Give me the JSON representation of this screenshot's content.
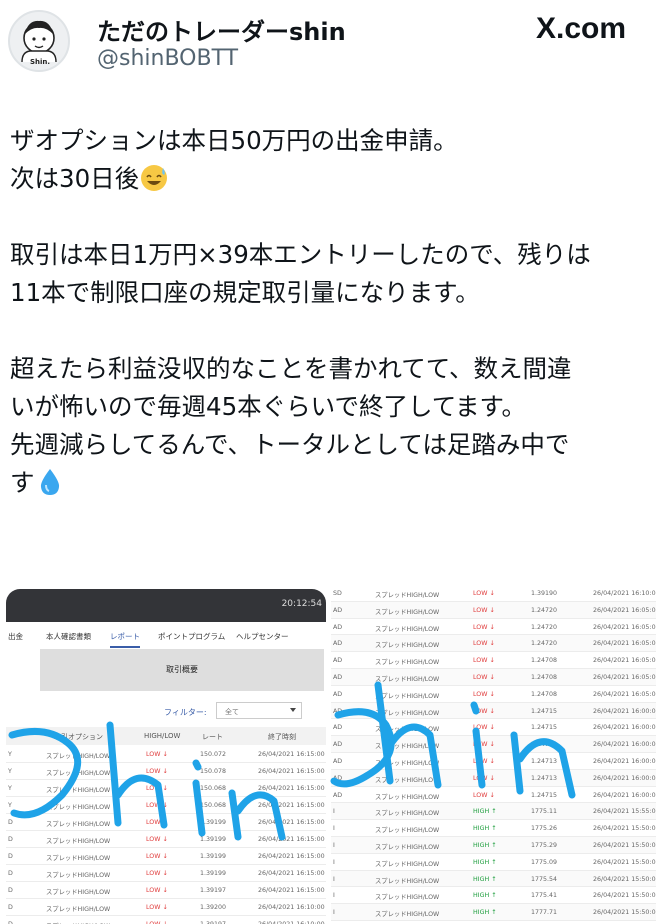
{
  "post": {
    "display_name": "ただのトレーダーshin",
    "handle": "@shinBOBTT",
    "site": "X.com",
    "avatar_label": "Shin.",
    "lines": [
      "ザオプションは本日50万円の出金申請。",
      "次は30日後",
      "",
      "取引は本日1万円×39本エントリーしたので、残りは",
      "11本で制限口座の規定取引量になります。",
      "",
      "超えたら利益没収的なことを書かれてて、数え間違",
      "いが怖いので毎週45本ぐらいで終了してます。",
      "先週減らしてるんで、トータルとしては足踏み中で",
      "す"
    ],
    "emojis": [
      "sweat-smile-emoji",
      "droplet-emoji"
    ]
  },
  "left_screenshot": {
    "clock": "20:12:54",
    "tabs": [
      "出金",
      "本人確認書類",
      "レポート",
      "ポイントプログラム",
      "ヘルプセンター"
    ],
    "active_tab": "レポート",
    "summary_button": "取引概要",
    "filter_label": "フィルター:",
    "filter_value": "全て",
    "headers": [
      "取引オプション",
      "HIGH/LOW",
      "レート",
      "終了時刻"
    ],
    "rows": [
      {
        "pair": "Y",
        "option": "スプレッドHIGH/LOW",
        "dir": "LOW",
        "rate": "150.072",
        "time": "26/04/2021 16:15:00"
      },
      {
        "pair": "Y",
        "option": "スプレッドHIGH/LOW",
        "dir": "LOW",
        "rate": "150.078",
        "time": "26/04/2021 16:15:00"
      },
      {
        "pair": "Y",
        "option": "スプレッドHIGH/LOW",
        "dir": "LOW",
        "rate": "150.068",
        "time": "26/04/2021 16:15:00"
      },
      {
        "pair": "Y",
        "option": "スプレッドHIGH/LOW",
        "dir": "LOW",
        "rate": "150.068",
        "time": "26/04/2021 16:15:00"
      },
      {
        "pair": "D",
        "option": "スプレッドHIGH/LOW",
        "dir": "LOW",
        "rate": "1.39199",
        "time": "26/04/2021 16:15:00"
      },
      {
        "pair": "D",
        "option": "スプレッドHIGH/LOW",
        "dir": "LOW",
        "rate": "1.39199",
        "time": "26/04/2021 16:15:00"
      },
      {
        "pair": "D",
        "option": "スプレッドHIGH/LOW",
        "dir": "LOW",
        "rate": "1.39199",
        "time": "26/04/2021 16:15:00"
      },
      {
        "pair": "D",
        "option": "スプレッドHIGH/LOW",
        "dir": "LOW",
        "rate": "1.39199",
        "time": "26/04/2021 16:15:00"
      },
      {
        "pair": "D",
        "option": "スプレッドHIGH/LOW",
        "dir": "LOW",
        "rate": "1.39197",
        "time": "26/04/2021 16:15:00"
      },
      {
        "pair": "D",
        "option": "スプレッドHIGH/LOW",
        "dir": "LOW",
        "rate": "1.39200",
        "time": "26/04/2021 16:10:00"
      },
      {
        "pair": "D",
        "option": "スプレッドHIGH/LOW",
        "dir": "LOW",
        "rate": "1.39197",
        "time": "26/04/2021 16:10:00"
      }
    ]
  },
  "right_screenshot": {
    "rows": [
      {
        "pair": "SD",
        "option": "スプレッドHIGH/LOW",
        "dir": "LOW",
        "rate": "1.39190",
        "time": "26/04/2021 16:10:0"
      },
      {
        "pair": "AD",
        "option": "スプレッドHIGH/LOW",
        "dir": "LOW",
        "rate": "1.24720",
        "time": "26/04/2021 16:05:00"
      },
      {
        "pair": "AD",
        "option": "スプレッドHIGH/LOW",
        "dir": "LOW",
        "rate": "1.24720",
        "time": "26/04/2021 16:05:00"
      },
      {
        "pair": "AD",
        "option": "スプレッドHIGH/LOW",
        "dir": "LOW",
        "rate": "1.24720",
        "time": "26/04/2021 16:05:00"
      },
      {
        "pair": "AD",
        "option": "スプレッドHIGH/LOW",
        "dir": "LOW",
        "rate": "1.24708",
        "time": "26/04/2021 16:05:00"
      },
      {
        "pair": "AD",
        "option": "スプレッドHIGH/LOW",
        "dir": "LOW",
        "rate": "1.24708",
        "time": "26/04/2021 16:05:00"
      },
      {
        "pair": "AD",
        "option": "スプレッドHIGH/LOW",
        "dir": "LOW",
        "rate": "1.24708",
        "time": "26/04/2021 16:05:00"
      },
      {
        "pair": "AD",
        "option": "スプレッドHIGH/LOW",
        "dir": "LOW",
        "rate": "1.24715",
        "time": "26/04/2021 16:00:00"
      },
      {
        "pair": "AD",
        "option": "スプレッドHIGH/LOW",
        "dir": "LOW",
        "rate": "1.24715",
        "time": "26/04/2021 16:00:00"
      },
      {
        "pair": "AD",
        "option": "スプレッドHIGH/LOW",
        "dir": "LOW",
        "rate": "1.24714",
        "time": "26/04/2021 16:00:00"
      },
      {
        "pair": "AD",
        "option": "スプレッドHIGH/LOW",
        "dir": "LOW",
        "rate": "1.24713",
        "time": "26/04/2021 16:00:00"
      },
      {
        "pair": "AD",
        "option": "スプレッドHIGH/LOW",
        "dir": "LOW",
        "rate": "1.24713",
        "time": "26/04/2021 16:00:00"
      },
      {
        "pair": "AD",
        "option": "スプレッドHIGH/LOW",
        "dir": "LOW",
        "rate": "1.24715",
        "time": "26/04/2021 16:00:00"
      },
      {
        "pair": "I",
        "option": "スプレッドHIGH/LOW",
        "dir": "HIGH",
        "rate": "1775.11",
        "time": "26/04/2021 15:55:00"
      },
      {
        "pair": "I",
        "option": "スプレッドHIGH/LOW",
        "dir": "HIGH",
        "rate": "1775.26",
        "time": "26/04/2021 15:50:00"
      },
      {
        "pair": "I",
        "option": "スプレッドHIGH/LOW",
        "dir": "HIGH",
        "rate": "1775.29",
        "time": "26/04/2021 15:50:00"
      },
      {
        "pair": "I",
        "option": "スプレッドHIGH/LOW",
        "dir": "HIGH",
        "rate": "1775.09",
        "time": "26/04/2021 15:50:00"
      },
      {
        "pair": "I",
        "option": "スプレッドHIGH/LOW",
        "dir": "HIGH",
        "rate": "1775.54",
        "time": "26/04/2021 15:50:00"
      },
      {
        "pair": "I",
        "option": "スプレッドHIGH/LOW",
        "dir": "HIGH",
        "rate": "1775.41",
        "time": "26/04/2021 15:50:00"
      },
      {
        "pair": "I",
        "option": "スプレッドHIGH/LOW",
        "dir": "HIGH",
        "rate": "1777.71",
        "time": "26/04/2021 15:50:00"
      }
    ]
  },
  "watermark": {
    "text": "shin",
    "color": "#1fa3e8"
  },
  "colors": {
    "low": "#e03c3c",
    "high": "#1e9e3e",
    "accent": "#3a5da8"
  }
}
